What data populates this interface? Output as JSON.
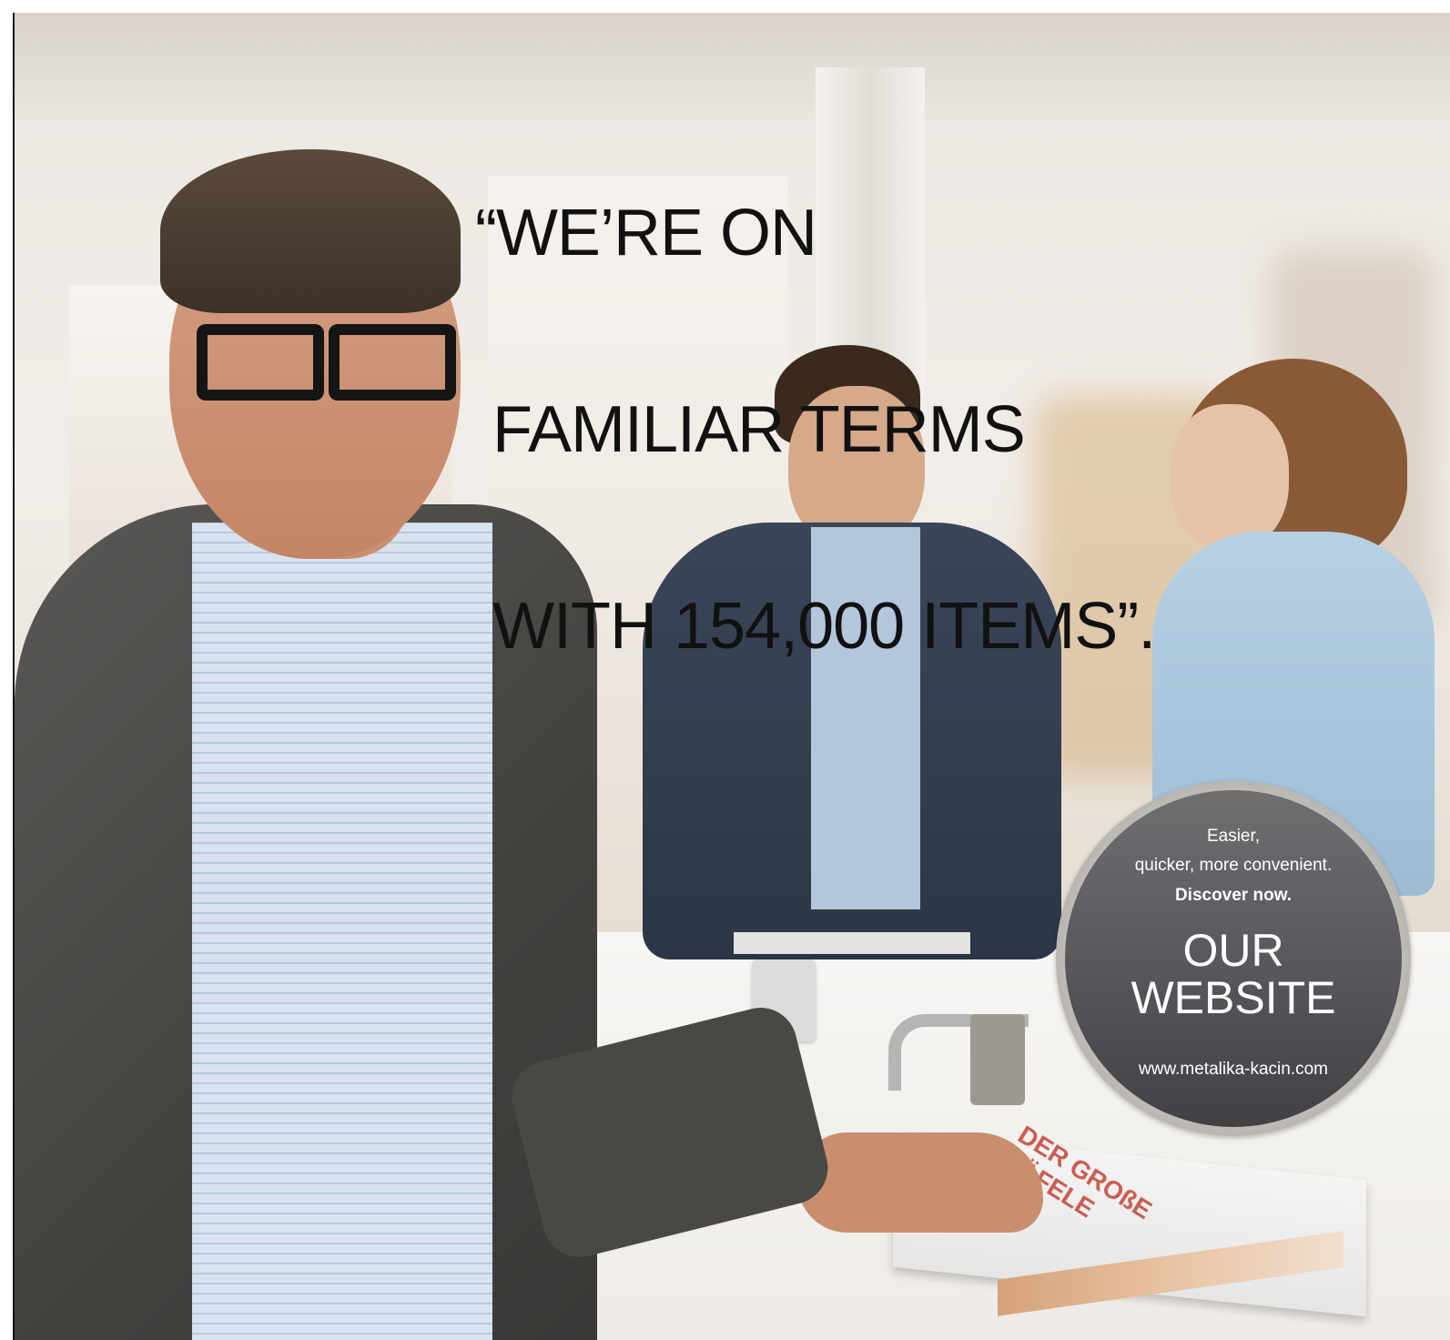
{
  "headline": {
    "line1": "“WE’RE ON",
    "line2": " FAMILIAR TERMS",
    "line3": " WITH 154,000 ITEMS”."
  },
  "badge": {
    "line1": "Easier,",
    "line2": "quicker, more convenient.",
    "cta": "Discover now.",
    "title_line1": "OUR",
    "title_line2": "WEBSITE",
    "url": "www.metalika-kacin.com"
  },
  "book_cover_text": "DER GROßE HÄFELE",
  "colors": {
    "headline_text": "#111111",
    "badge_fill": "#55575a",
    "badge_text": "#ffffff"
  }
}
